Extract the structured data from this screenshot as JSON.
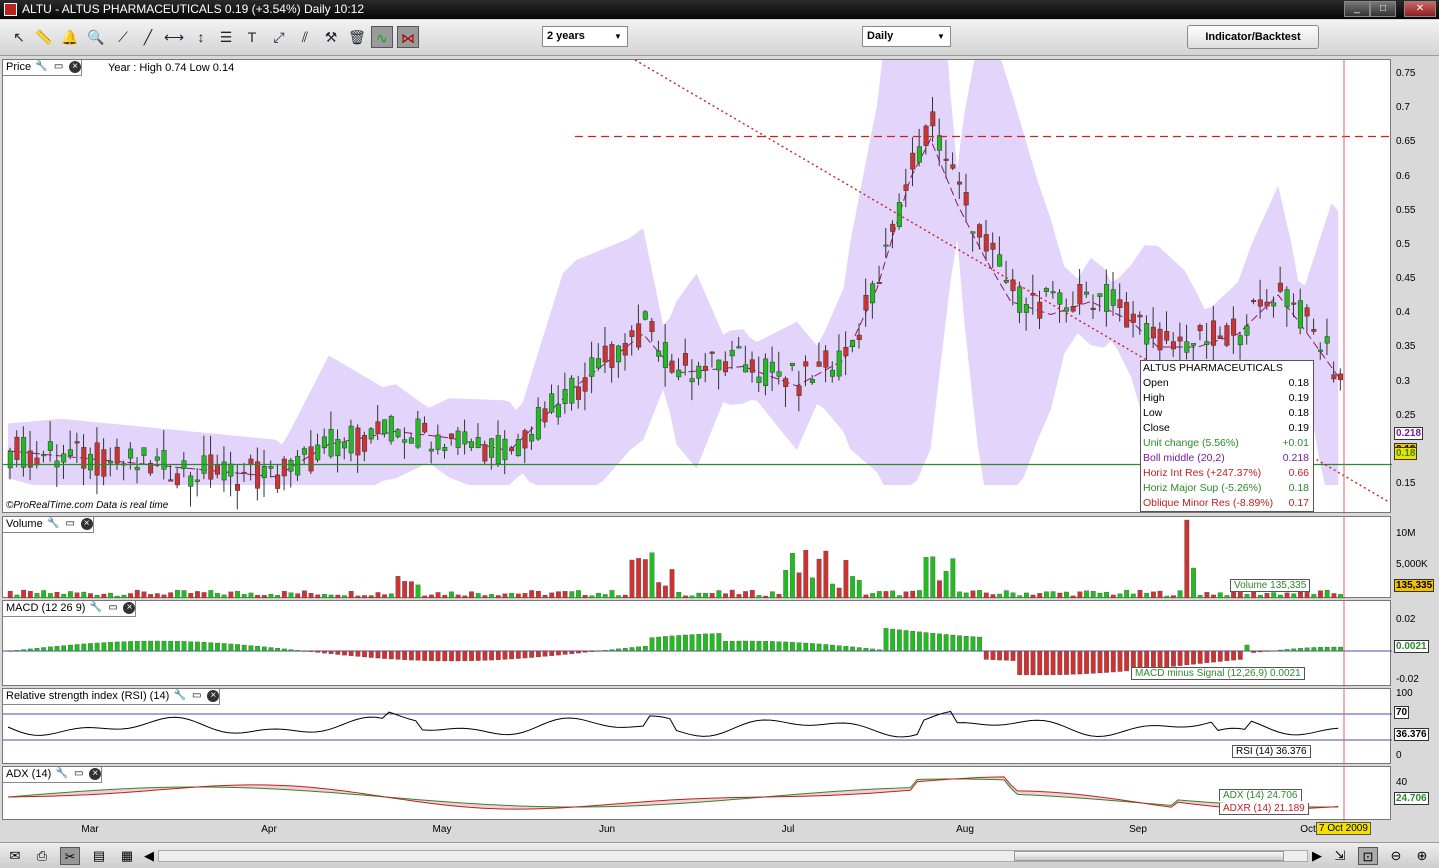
{
  "window": {
    "title": "ALTU - ALTUS PHARMACEUTICALS    0.19 (+3.54%)    Daily  10:12",
    "buttons": [
      "_",
      "□",
      "✕"
    ]
  },
  "toolbar": {
    "period": "2 years",
    "interval": "Daily",
    "indicator_button": "Indicator/Backtest",
    "tools": [
      "pointer-icon",
      "ruler-icon",
      "alarm-icon",
      "zoom-icon",
      "line-icon",
      "trendline-icon",
      "horizontal-line-icon",
      "vertical-line-icon",
      "fib-icon",
      "text-icon",
      "arrow-icon",
      "channel-icon",
      "tools-icon",
      "trash-icon",
      "indicator-icon",
      "pattern-icon"
    ]
  },
  "price": {
    "label": "Price",
    "year_info": "Year : High 0.74 Low 0.14",
    "watermark": "©ProRealTime.com  Data is real time",
    "ticks": [
      "0.75",
      "0.7",
      "0.65",
      "0.6",
      "0.55",
      "0.5",
      "0.45",
      "0.4",
      "0.35",
      "0.3",
      "0.25",
      "0.2",
      "0.15"
    ],
    "tags": {
      "boll": "0.218",
      "close": "0.19",
      "sup": "0.18"
    }
  },
  "infobox": {
    "title": "ALTUS PHARMACEUTICALS",
    "rows": [
      {
        "k": "Open",
        "v": "0.18",
        "c": "#000"
      },
      {
        "k": "High",
        "v": "0.19",
        "c": "#000"
      },
      {
        "k": "Low",
        "v": "0.18",
        "c": "#000"
      },
      {
        "k": "Close",
        "v": "0.19",
        "c": "#000"
      },
      {
        "k": "Unit change (5.56%)",
        "v": "+0.01",
        "c": "#2a8a2a"
      },
      {
        "k": "Boll middle (20,2)",
        "v": "0.218",
        "c": "#7a1a9a"
      },
      {
        "k": "Horiz Int Res (+247.37%)",
        "v": "0.66",
        "c": "#c02020"
      },
      {
        "k": "Horiz Major Sup (-5.26%)",
        "v": "0.18",
        "c": "#2a8a2a"
      },
      {
        "k": "Oblique Minor Res (-8.89%)",
        "v": "0.17",
        "c": "#c02020"
      }
    ]
  },
  "volume": {
    "label": "Volume",
    "ticks": [
      "10M",
      "5,000K"
    ],
    "tag": "135,335",
    "caption": "Volume 135,335"
  },
  "macd": {
    "label": "MACD (12 26 9)",
    "ticks": [
      "0.02",
      "-0.02"
    ],
    "tag": "0.0021",
    "caption": "MACD minus Signal (12,26,9) 0.0021"
  },
  "rsi": {
    "label": "Relative strength index (RSI) (14)",
    "ticks": [
      "100",
      "70",
      "0"
    ],
    "tag": "36.376",
    "caption": "RSI (14) 36.376"
  },
  "adx": {
    "label": "ADX (14)",
    "ticks": [
      "40"
    ],
    "tag": "24.706",
    "caption_adx": "ADX (14)  24.706",
    "caption_adxr": "ADXR (14) 21.189"
  },
  "xaxis": {
    "months": [
      "Mar",
      "Apr",
      "May",
      "Jun",
      "Jul",
      "Aug",
      "Sep",
      "Oct"
    ],
    "cursor_date": "7 Oct 2009"
  },
  "colors": {
    "up": "#22bb22",
    "down": "#cc3333",
    "boll": "#e2d4fa",
    "accent": "#f2c200"
  }
}
